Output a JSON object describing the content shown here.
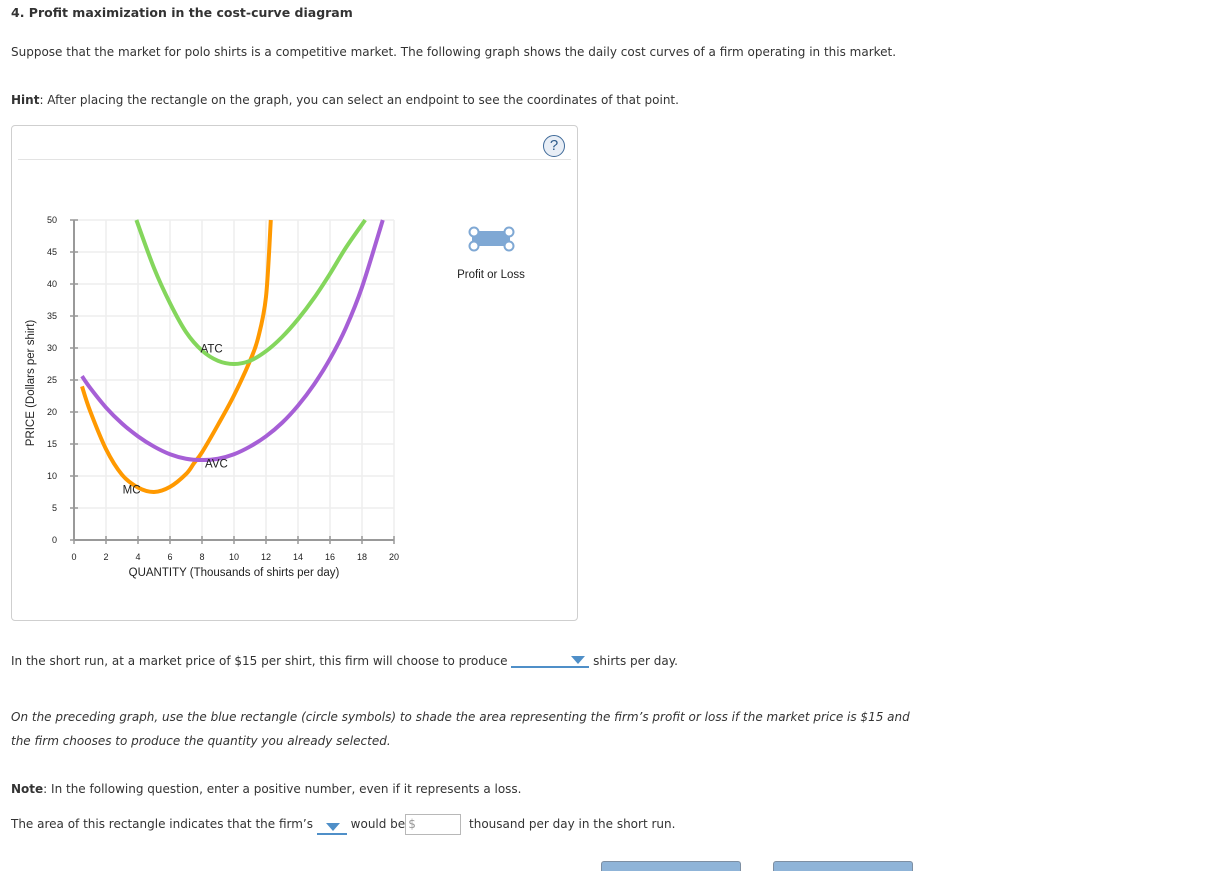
{
  "question": {
    "title": "4. Profit maximization in the cost-curve diagram",
    "intro": "Suppose that the market for polo shirts is a competitive market. The following graph shows the daily cost curves of a firm operating in this market.",
    "hint_label": "Hint",
    "hint_text": ": After placing the rectangle on the graph, you can select an endpoint to see the coordinates of that point."
  },
  "graph": {
    "help_icon": "?",
    "tool_label": "Profit or Loss",
    "tool_color": "#7fa8d4"
  },
  "chart_data": {
    "type": "line",
    "xlabel": "QUANTITY (Thousands of shirts per day)",
    "ylabel": "PRICE (Dollars per shirt)",
    "xlim": [
      0,
      20
    ],
    "ylim": [
      0,
      50
    ],
    "xticks": [
      0,
      2,
      4,
      6,
      8,
      10,
      12,
      14,
      16,
      18,
      20
    ],
    "yticks": [
      0,
      5,
      10,
      15,
      20,
      25,
      30,
      35,
      40,
      45,
      50
    ],
    "grid": true,
    "series": [
      {
        "name": "MC",
        "color": "#ff9900",
        "points": [
          [
            0.5,
            24
          ],
          [
            1,
            20.2
          ],
          [
            2,
            14.2
          ],
          [
            3,
            10.2
          ],
          [
            4,
            8.2
          ],
          [
            5,
            7.5
          ],
          [
            6,
            8.3
          ],
          [
            7,
            10.3
          ],
          [
            7.5,
            12
          ],
          [
            8,
            13.7
          ],
          [
            9,
            18
          ],
          [
            10,
            22.6
          ],
          [
            11,
            28
          ],
          [
            11.5,
            31.5
          ],
          [
            12,
            38
          ],
          [
            12.3,
            50
          ]
        ],
        "label_at": [
          3.6,
          7.3
        ]
      },
      {
        "name": "AVC",
        "color": "#a65fd6",
        "points": [
          [
            0.5,
            25.6
          ],
          [
            1,
            23.8
          ],
          [
            2,
            20.7
          ],
          [
            3,
            18.2
          ],
          [
            4,
            16.2
          ],
          [
            5,
            14.6
          ],
          [
            6,
            13.4
          ],
          [
            7,
            12.7
          ],
          [
            8,
            12.5
          ],
          [
            9,
            12.7
          ],
          [
            10,
            13.4
          ],
          [
            11,
            14.6
          ],
          [
            12,
            16.2
          ],
          [
            13,
            18.3
          ],
          [
            14,
            21
          ],
          [
            15,
            24.3
          ],
          [
            16,
            28.3
          ],
          [
            17,
            33.2
          ],
          [
            18,
            39.5
          ],
          [
            19.3,
            50
          ]
        ],
        "label_at": [
          8.9,
          11.3
        ]
      },
      {
        "name": "ATC",
        "color": "#84d65c",
        "points": [
          [
            3.9,
            50
          ],
          [
            5,
            42.5
          ],
          [
            6,
            37
          ],
          [
            7,
            32.5
          ],
          [
            8,
            29.6
          ],
          [
            9,
            28
          ],
          [
            10,
            27.5
          ],
          [
            11,
            28
          ],
          [
            12,
            29.5
          ],
          [
            13,
            31.7
          ],
          [
            14,
            34.5
          ],
          [
            15,
            37.8
          ],
          [
            16,
            41.6
          ],
          [
            17,
            45.7
          ],
          [
            18.2,
            50
          ]
        ],
        "label_at": [
          8.6,
          29.3
        ]
      }
    ]
  },
  "q1": {
    "prefix": "In the short run, at a market price of $15 per shirt, this firm will choose to produce",
    "selected": "",
    "suffix": "shirts per day."
  },
  "q2": {
    "line1": "On the preceding graph, use the blue rectangle (circle symbols) to shade the area representing the firm’s profit or loss if the market price is $15 and",
    "line2": "the firm chooses to produce the quantity you already selected."
  },
  "note": {
    "label": "Note",
    "text": ": In the following question, enter a positive number, even if it represents a loss."
  },
  "q3": {
    "prefix": "The area of this rectangle indicates that the firm’s",
    "selected": "",
    "middle": "would be",
    "currency": "$",
    "value": "",
    "suffix": "thousand per day in the short run."
  }
}
